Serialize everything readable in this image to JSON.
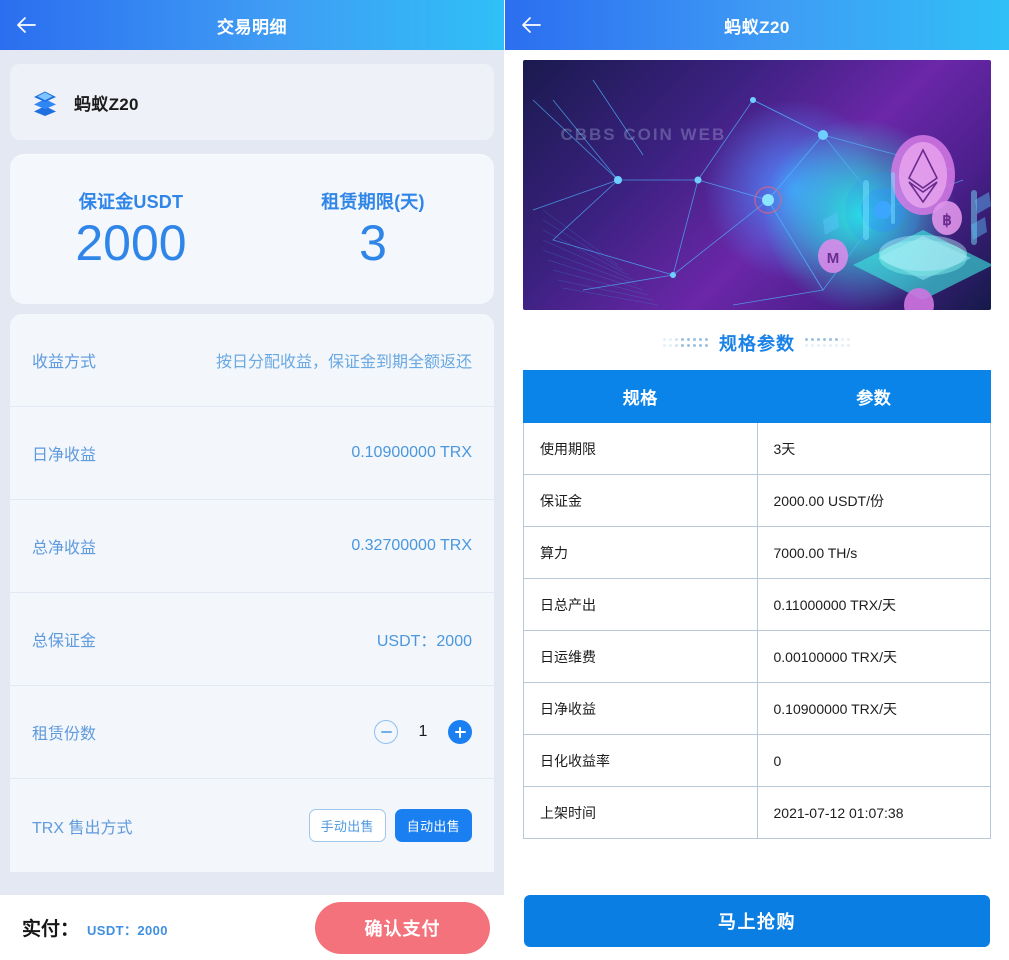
{
  "left": {
    "header": {
      "title": "交易明细",
      "back_icon": "arrow-left-icon"
    },
    "product": {
      "icon": "stacked-cube-icon",
      "name": "蚂蚁Z20"
    },
    "summary": [
      {
        "label": "保证金USDT",
        "value": "2000"
      },
      {
        "label": "租赁期限(天)",
        "value": "3"
      }
    ],
    "details": [
      {
        "label": "收益方式",
        "value": "按日分配收益，保证金到期全额返还"
      },
      {
        "label": "日净收益",
        "value": "0.10900000 TRX"
      },
      {
        "label": "总净收益",
        "value": "0.32700000 TRX"
      },
      {
        "label": "总保证金",
        "value": "USDT：2000"
      }
    ],
    "shares": {
      "label": "租赁份数",
      "count": "1",
      "minus_icon": "minus-circle-icon",
      "plus_icon": "plus-circle-icon"
    },
    "sell_mode": {
      "label": "TRX 售出方式",
      "options": [
        "手动出售",
        "自动出售"
      ],
      "selected": "自动出售"
    },
    "paybar": {
      "label": "实付：",
      "amount": "USDT：2000",
      "button": "确认支付",
      "button_color": "#f4727c"
    }
  },
  "right": {
    "header": {
      "title": "蚂蚁Z20",
      "back_icon": "arrow-left-icon"
    },
    "banner": {
      "watermark": "CBBS COIN WEB",
      "alt": "blockchain-crypto-banner"
    },
    "spec_title": "规格参数",
    "spec_table": {
      "columns": [
        "规格",
        "参数"
      ],
      "rows": [
        [
          "使用期限",
          "3天"
        ],
        [
          "保证金",
          "2000.00 USDT/份"
        ],
        [
          "算力",
          "7000.00 TH/s"
        ],
        [
          "日总产出",
          "0.11000000 TRX/天"
        ],
        [
          "日运维费",
          "0.00100000 TRX/天"
        ],
        [
          "日净收益",
          "0.10900000 TRX/天"
        ],
        [
          "日化收益率",
          "0"
        ],
        [
          "上架时间",
          "2021-07-12 01:07:38"
        ]
      ]
    },
    "buy_button": {
      "label": "马上抢购",
      "color": "#0a7ee3"
    }
  },
  "theme": {
    "header_gradient_start": "#2b6ef0",
    "header_gradient_end": "#2fc0f7",
    "accent_blue": "#1a7ff0",
    "label_blue": "#5f9bdc",
    "page_bg": "#e3e8f3",
    "card_bg": "#f4f7fb"
  }
}
